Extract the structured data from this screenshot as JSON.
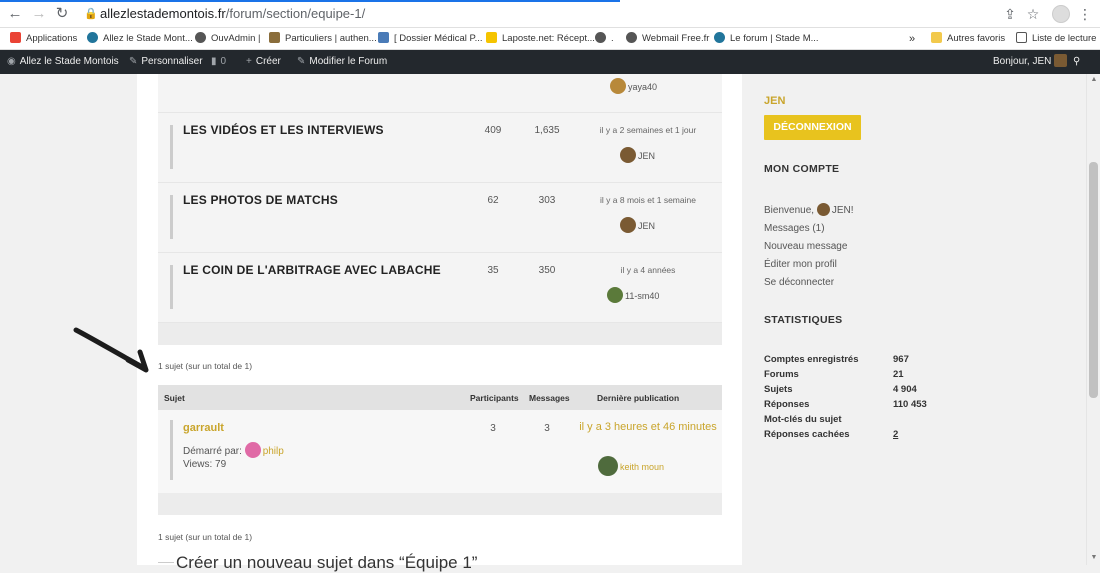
{
  "browser": {
    "url_host": "allezlestademontois.fr",
    "url_path": "/forum/section/equipe-1/"
  },
  "bookmarks": [
    {
      "label": "Applications",
      "color": "#ea4335"
    },
    {
      "label": "Allez le Stade Mont...",
      "color": "#21759b"
    },
    {
      "label": "OuvAdmin |",
      "color": "#555555"
    },
    {
      "label": "Particuliers | authen...",
      "color": "#8a6d3b"
    },
    {
      "label": "[ Dossier Médical P...",
      "color": "#4a7bb7"
    },
    {
      "label": "Laposte.net: Récept...",
      "color": "#f5c400"
    },
    {
      "label": ".",
      "color": "#555555"
    },
    {
      "label": "Webmail Free.fr",
      "color": "#555555"
    },
    {
      "label": "Le forum | Stade M...",
      "color": "#21759b"
    },
    {
      "label": "»",
      "color": ""
    },
    {
      "label": "Autres favoris",
      "color": "#f2c94c"
    },
    {
      "label": "Liste de lecture",
      "color": "#555555"
    }
  ],
  "adminbar": {
    "site": "Allez le Stade Montois",
    "customize": "Personnaliser",
    "comments": "0",
    "create": "Créer",
    "edit": "Modifier le Forum",
    "greeting": "Bonjour, JEN"
  },
  "forums": [
    {
      "title": "",
      "topics": "",
      "posts": "",
      "freshness": "",
      "author": "yaya40",
      "avatar": "#b8893a"
    },
    {
      "title": "LES VIDÉOS ET LES INTERVIEWS",
      "topics": "409",
      "posts": "1,635",
      "freshness": "il y a 2 semaines et 1 jour",
      "author": "JEN",
      "avatar": "#7a5a33"
    },
    {
      "title": "LES PHOTOS DE MATCHS",
      "topics": "62",
      "posts": "303",
      "freshness": "il y a 8 mois et 1 semaine",
      "author": "JEN",
      "avatar": "#7a5a33"
    },
    {
      "title": "LE COIN DE L'ARBITRAGE AVEC LABACHE",
      "topics": "35",
      "posts": "350",
      "freshness": "il y a 4 années",
      "author": "11-sm40",
      "avatar": "#5b7a3a"
    }
  ],
  "topics_list": {
    "count_text_top": "1 sujet (sur un total de 1)",
    "count_text_bottom": "1 sujet (sur un total de 1)",
    "headers": {
      "topic": "Sujet",
      "participants": "Participants",
      "posts": "Messages",
      "last": "Dernière publication"
    },
    "topic": {
      "title": "garrault",
      "started_by_label": "Démarré par:",
      "started_by": "philp",
      "views": "Views: 79",
      "participants": "3",
      "posts": "3",
      "freshness": "il y a 3 heures et 46 minutes",
      "last_author": "keith moun"
    },
    "new_topic": "Créer un nouveau sujet dans “Équipe 1”"
  },
  "sidebar": {
    "username": "JEN",
    "logout": "DÉCONNEXION",
    "account_title": "MON COMPTE",
    "welcome": "Bienvenue,",
    "welcome_user": "JEN!",
    "links": [
      "Messages (1)",
      "Nouveau message",
      "Éditer mon profil",
      "Se déconnecter"
    ],
    "stats_title": "STATISTIQUES",
    "stats": [
      {
        "label": "Comptes enregistrés",
        "value": "967"
      },
      {
        "label": "Forums",
        "value": "21"
      },
      {
        "label": "Sujets",
        "value": "4 904"
      },
      {
        "label": "Réponses",
        "value": "110 453"
      },
      {
        "label": "Mot-clés du sujet",
        "value": ""
      },
      {
        "label": "Réponses cachées",
        "value": "2"
      }
    ]
  },
  "colors": {
    "accent": "#c9a52c",
    "button": "#e8c31e",
    "adminbar": "#23282d"
  }
}
